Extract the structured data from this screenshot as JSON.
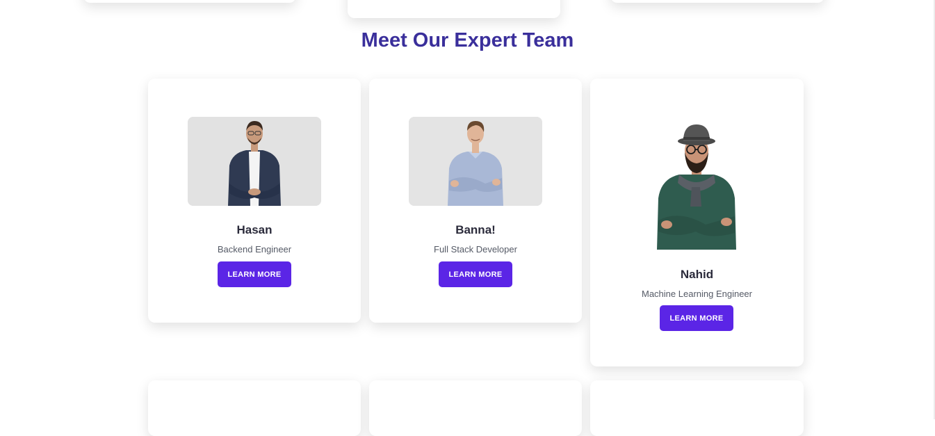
{
  "section": {
    "title": "Meet Our Expert Team"
  },
  "team": [
    {
      "name": "Hasan",
      "role": "Backend Engineer",
      "button_label": "LEARN MORE"
    },
    {
      "name": "Banna!",
      "role": "Full Stack Developer",
      "button_label": "LEARN MORE"
    },
    {
      "name": "Nahid",
      "role": "Machine Learning Engineer",
      "button_label": "LEARN MORE"
    }
  ],
  "colors": {
    "title": "#3a2f9b",
    "button": "#5b25e6",
    "photo_background": "#e3e3e3"
  }
}
